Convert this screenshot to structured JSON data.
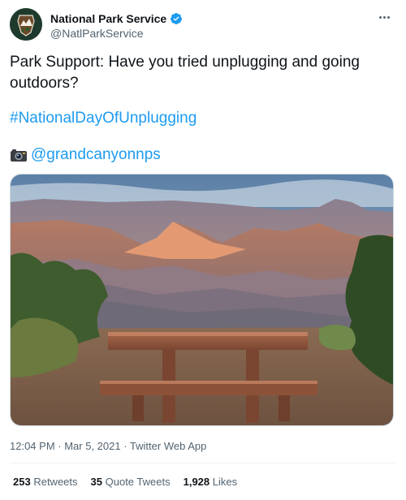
{
  "author": {
    "display_name": "National Park Service",
    "handle": "@NatlParkService",
    "verified_icon": "verified-badge-icon",
    "avatar_icon": "nps-arrowhead-logo",
    "avatar_color": "#1e3a2c"
  },
  "tweet": {
    "text": "Park Support: Have you tried unplugging and going outdoors?",
    "hashtag": "#NationalDayOfUnplugging",
    "camera_icon": "camera-icon",
    "mention": "@grandcanyonnps"
  },
  "media": {
    "description_icon": "grand-canyon-photo"
  },
  "meta": {
    "time": "12:04 PM",
    "sep1": " · ",
    "date": "Mar 5, 2021",
    "sep2": " · ",
    "source": "Twitter Web App"
  },
  "stats": {
    "retweets_count": "253",
    "retweets_label": "Retweets",
    "quotes_count": "35",
    "quotes_label": "Quote Tweets",
    "likes_count": "1,928",
    "likes_label": "Likes"
  },
  "colors": {
    "link": "#1d9bf0",
    "secondary_text": "#536471",
    "primary_text": "#0f1419"
  }
}
